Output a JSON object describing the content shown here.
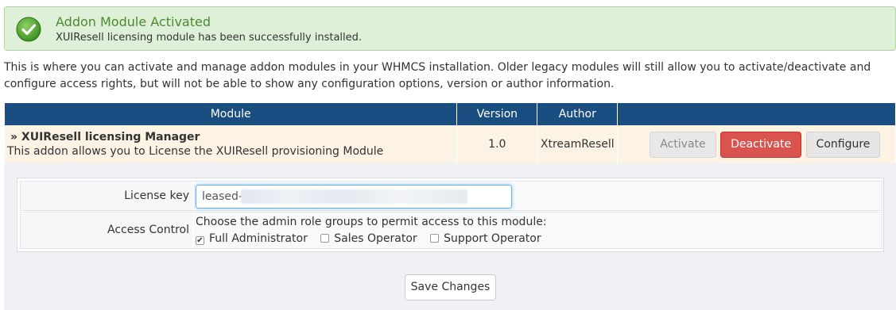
{
  "alert": {
    "title": "Addon Module Activated",
    "message": "XUIResell licensing module has been successfully installed."
  },
  "intro": {
    "text": "This is where you can activate and manage addon modules in your WHMCS installation. Older legacy modules will still allow you to activate/deactivate and configure access rights, but will not be able to show any configuration options, version or author information."
  },
  "table": {
    "headers": [
      "Module",
      "Version",
      "Author",
      ""
    ],
    "module": {
      "name": "» XUIResell licensing Manager",
      "description": "This addon allows you to License the XUIResell provisioning Module",
      "version": "1.0",
      "author": "XtreamResell",
      "buttons": {
        "activate": "Activate",
        "deactivate": "Deactivate",
        "configure": "Configure"
      }
    }
  },
  "config": {
    "license_label": "License key",
    "license_value": "leased-",
    "access_label": "Access Control",
    "access_prompt": "Choose the admin role groups to permit access to this module:",
    "roles": [
      {
        "label": "Full Administrator",
        "checked": true
      },
      {
        "label": "Sales Operator",
        "checked": false
      },
      {
        "label": "Support Operator",
        "checked": false
      }
    ],
    "save_label": "Save Changes"
  },
  "colors": {
    "header_blue": "#1a4d80",
    "success_bg": "#dff0d8",
    "danger": "#d9534f",
    "row_bg": "#fcf3e5"
  }
}
